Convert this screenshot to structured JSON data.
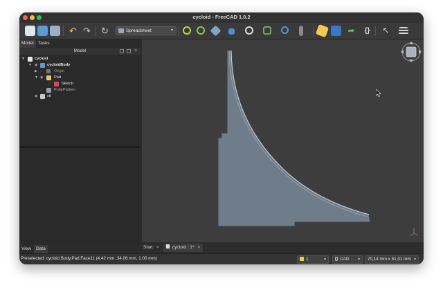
{
  "window": {
    "title": "cycloid - FreeCAD 1.0.2"
  },
  "toolbar": {
    "workbench": "Spreadsheet",
    "icons": [
      "new-document-icon",
      "open-document-icon",
      "save-document-icon",
      "undo-icon",
      "redo-icon",
      "refresh-icon",
      "zoom-fit-icon",
      "zoom-selection-icon",
      "isometric-view-icon",
      "measure-icon",
      "draw-style-icon",
      "view-selector-icon",
      "zoom-icon",
      "clipping-icon",
      "part-icon",
      "folder-icon",
      "link-icon",
      "macro-icon",
      "whats-this-icon",
      "toggle-panel-icon"
    ]
  },
  "left_panel": {
    "tabs": [
      "Model",
      "Tasks"
    ],
    "header": "Model",
    "tree": [
      {
        "label": "cycloid",
        "depth": 0,
        "expanded": true,
        "icon": "document-icon"
      },
      {
        "label": "cycloidBody",
        "depth": 1,
        "expanded": true,
        "icon": "body-icon",
        "bold": true
      },
      {
        "label": "Origin",
        "depth": 2,
        "expanded": false,
        "icon": "origin-icon",
        "dim": true
      },
      {
        "label": "Pad",
        "depth": 2,
        "expanded": true,
        "icon": "pad-icon"
      },
      {
        "label": "Sketch",
        "depth": 3,
        "icon": "sketch-icon"
      },
      {
        "label": "PolarPattern",
        "depth": 2,
        "icon": "polar-pattern-icon",
        "dim": true
      },
      {
        "label": "xit",
        "depth": 1,
        "icon": "part-icon"
      }
    ],
    "bottom_tabs": [
      "View",
      "Data"
    ]
  },
  "doc_tabs": [
    {
      "label": "Start",
      "active": false
    },
    {
      "label": "cycloid : 1*",
      "active": true
    }
  ],
  "status": {
    "text": "Preselected: cycloid.Body.Pad.Face11 (4.42 mm, 34.06 mm, 1.00 mm)",
    "layer": "1",
    "nav_style": "CAD",
    "dimensions": "70,14 mm x 51,01 mm"
  },
  "colors": {
    "shape_fill": "#6f7d8a",
    "shape_edge": "#c7cdd3",
    "viewport_bg": "#3d3d3d"
  }
}
